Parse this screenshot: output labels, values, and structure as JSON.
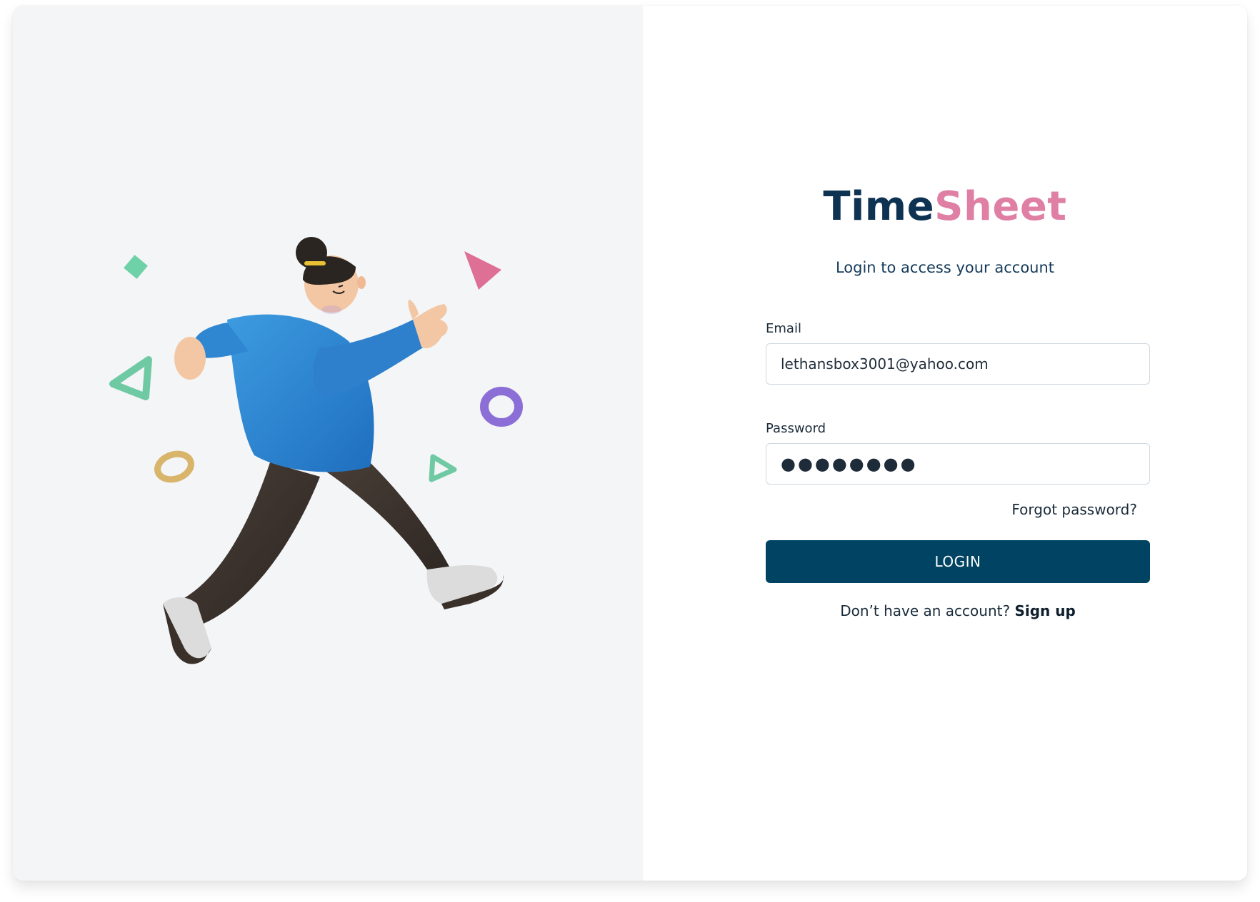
{
  "brand": {
    "part_a": "Time",
    "part_b": "Sheet",
    "color_a": "#0e3252",
    "color_b": "#de7fa3"
  },
  "subtitle": "Login to access your account",
  "form": {
    "email_label": "Email",
    "email_value": "lethansbox3001@yahoo.com",
    "password_label": "Password",
    "password_value": "●●●●●●●●",
    "forgot_label": "Forgot password?",
    "login_label": "LOGIN",
    "signup_prompt": "Don’t have an account?",
    "signup_link": "Sign up"
  },
  "illustration": {
    "subject": "running-person-illustration",
    "shapes": [
      "green-diamond-shape",
      "green-triangle-shape",
      "pink-triangle-shape",
      "purple-ring-shape",
      "gold-ring-shape",
      "green-small-triangle-shape"
    ]
  },
  "colors": {
    "primary_button": "#004362",
    "left_panel_bg": "#f3f5f7"
  }
}
